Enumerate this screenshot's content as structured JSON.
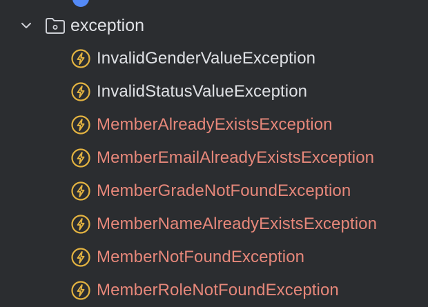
{
  "colors": {
    "background": "#2b2d30",
    "text_default": "#dfe1e5",
    "text_error": "#e6877a",
    "icon_exception": "#e3b341",
    "icon_folder": "#ced0d6",
    "partial_icon": "#548af7"
  },
  "tree": {
    "folder": {
      "label": "exception",
      "icon": "folder-icon",
      "expand_icon": "chevron-down-icon"
    },
    "items": [
      {
        "label": "InvalidGenderValueException",
        "icon": "lightning-icon",
        "status": "default"
      },
      {
        "label": "InvalidStatusValueException",
        "icon": "lightning-icon",
        "status": "default"
      },
      {
        "label": "MemberAlreadyExistsException",
        "icon": "lightning-icon",
        "status": "error"
      },
      {
        "label": "MemberEmailAlreadyExistsException",
        "icon": "lightning-icon",
        "status": "error"
      },
      {
        "label": "MemberGradeNotFoundException",
        "icon": "lightning-icon",
        "status": "error"
      },
      {
        "label": "MemberNameAlreadyExistsException",
        "icon": "lightning-icon",
        "status": "error"
      },
      {
        "label": "MemberNotFoundException",
        "icon": "lightning-icon",
        "status": "error"
      },
      {
        "label": "MemberRoleNotFoundException",
        "icon": "lightning-icon",
        "status": "error"
      }
    ]
  }
}
